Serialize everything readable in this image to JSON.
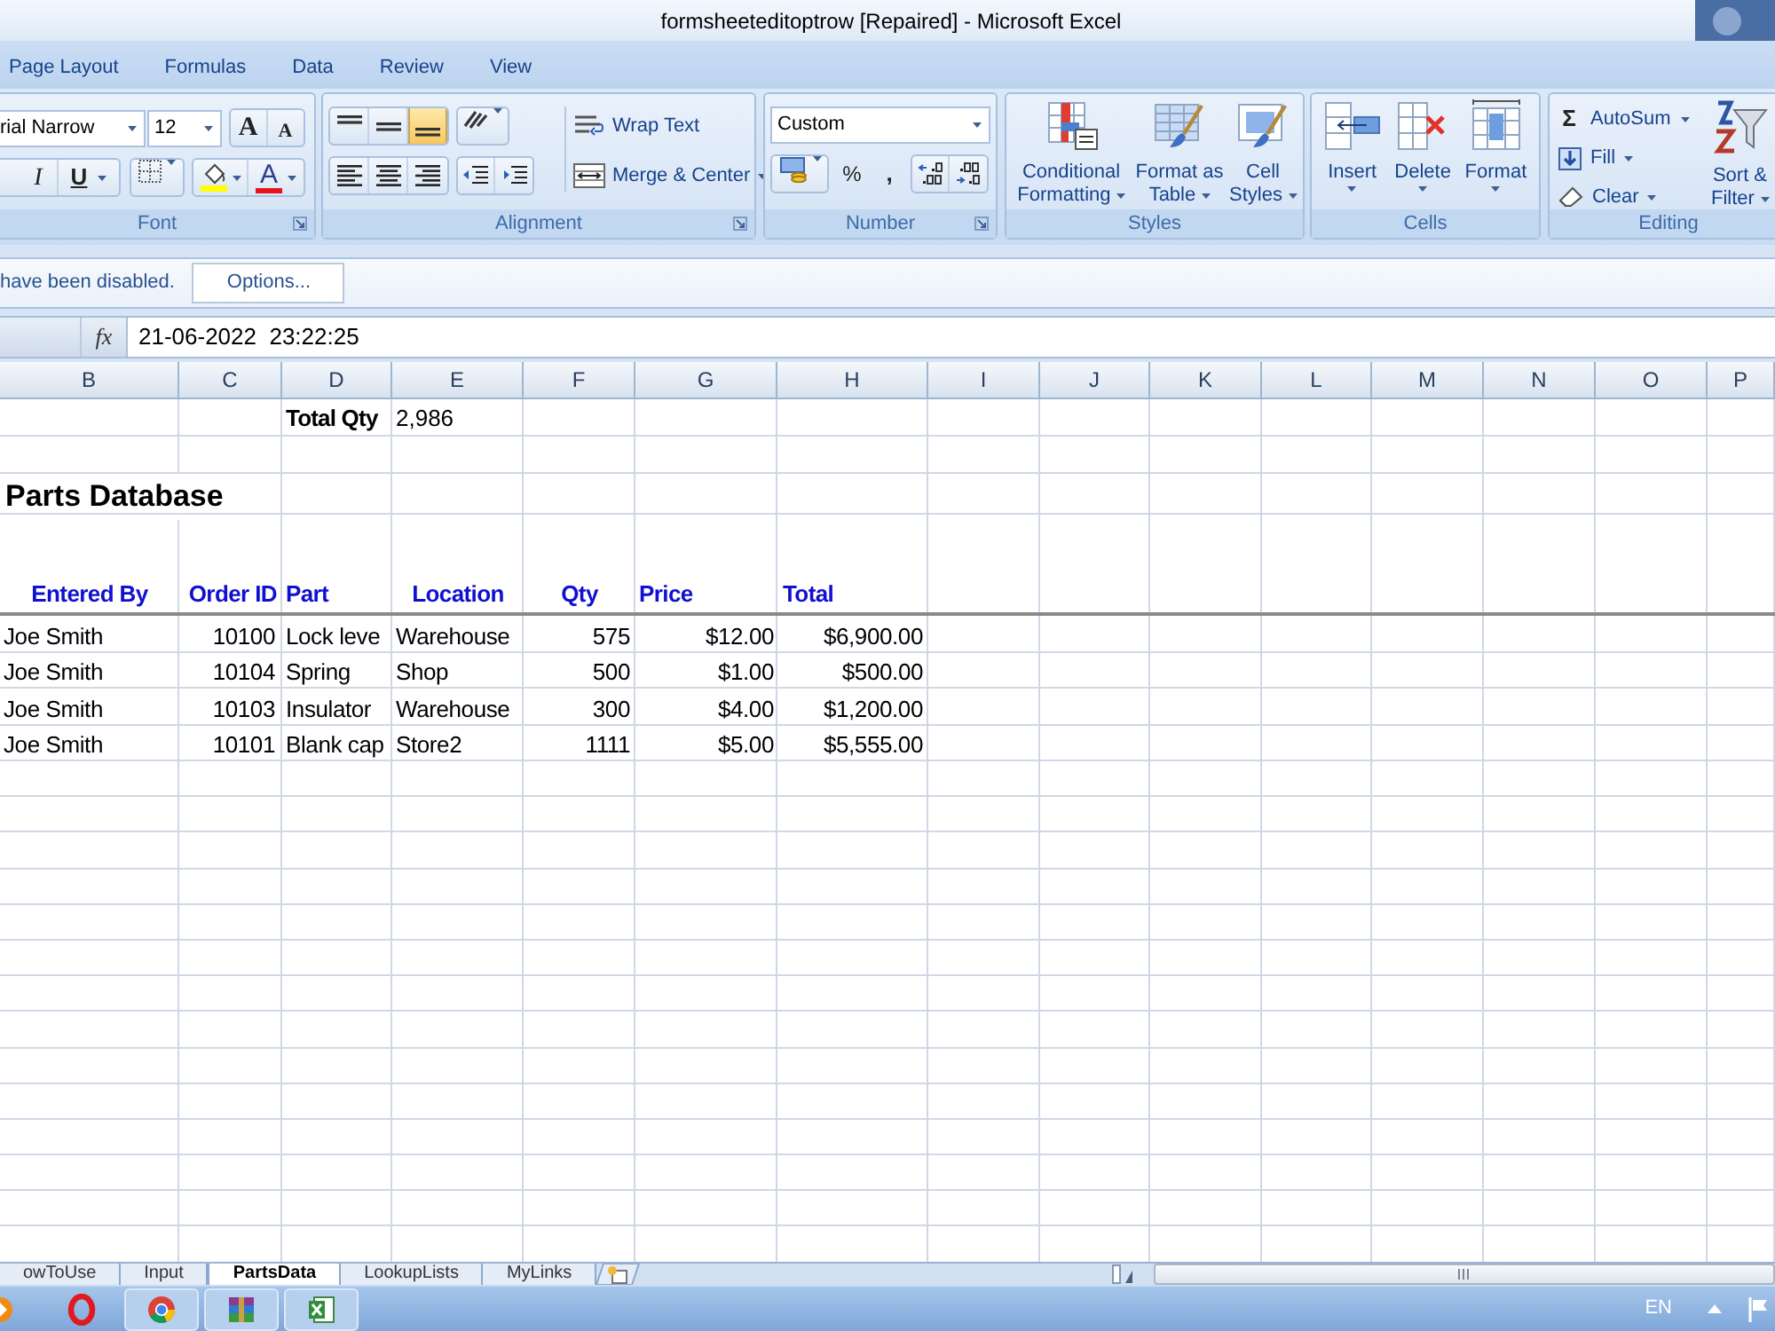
{
  "window": {
    "title": "formsheeteditoptrow [Repaired] - Microsoft Excel"
  },
  "ribbon_tabs": [
    {
      "label": "Page Layout",
      "selected": false
    },
    {
      "label": "Formulas",
      "selected": false
    },
    {
      "label": "Data",
      "selected": false
    },
    {
      "label": "Review",
      "selected": false
    },
    {
      "label": "View",
      "selected": false
    }
  ],
  "ribbon": {
    "font": {
      "label": "Font",
      "font_name": "rial Narrow",
      "font_size": "12",
      "grow_font": "A",
      "shrink_font": "A",
      "italic": "I",
      "underline": "U",
      "font_color": "A"
    },
    "alignment": {
      "label": "Alignment",
      "vertical": [
        {
          "kind": "top",
          "selected": false
        },
        {
          "kind": "middle",
          "selected": false
        },
        {
          "kind": "bottom",
          "selected": true
        }
      ],
      "horizontal": [
        {
          "kind": "left",
          "selected": false
        },
        {
          "kind": "center",
          "selected": false
        },
        {
          "kind": "right",
          "selected": false
        }
      ],
      "wrap_text": "Wrap Text",
      "merge_center": "Merge & Center"
    },
    "number": {
      "label": "Number",
      "format": "Custom",
      "percent": "%",
      "comma": ","
    },
    "styles": {
      "label": "Styles",
      "buttons": [
        {
          "kind": "conditional",
          "label": "Conditional Formatting"
        },
        {
          "kind": "table",
          "label": "Format as Table"
        },
        {
          "kind": "cell",
          "label": "Cell Styles"
        }
      ]
    },
    "cells": {
      "label": "Cells",
      "buttons": [
        {
          "kind": "insert",
          "label": "Insert"
        },
        {
          "kind": "delete",
          "label": "Delete"
        },
        {
          "kind": "format",
          "label": "Format"
        }
      ]
    },
    "editing": {
      "label": "Editing",
      "autosum_symbol": "Σ",
      "autosum": "AutoSum",
      "fill": "Fill",
      "clear": "Clear",
      "sort_filter": "Sort & Filter"
    }
  },
  "message_bar": {
    "text": "have been disabled.",
    "button": "Options..."
  },
  "formula_bar": {
    "function_label": "fx",
    "value": "21-06-2022  23:22:25"
  },
  "sheet": {
    "columns": [
      "B",
      "C",
      "D",
      "E",
      "F",
      "G",
      "H",
      "I",
      "J",
      "K",
      "L",
      "M",
      "N",
      "O",
      "P"
    ],
    "total": {
      "label": "Total Qty",
      "value": "2,986"
    },
    "title": "Parts Database",
    "table": {
      "columns": [
        "Entered By",
        "Order ID",
        "Part",
        "Location",
        "Qty",
        "Price",
        "Total"
      ],
      "rows": [
        [
          "Joe Smith",
          "10100",
          "Lock leve",
          "Warehouse",
          "575",
          "$12.00",
          "$6,900.00"
        ],
        [
          "Joe Smith",
          "10104",
          "Spring",
          "Shop",
          "500",
          "$1.00",
          "$500.00"
        ],
        [
          "Joe Smith",
          "10103",
          "Insulator",
          "Warehouse",
          "300",
          "$4.00",
          "$1,200.00"
        ],
        [
          "Joe Smith",
          "10101",
          "Blank cap",
          "Store2",
          "1111",
          "$5.00",
          "$5,555.00"
        ]
      ]
    }
  },
  "sheet_tabs": [
    {
      "label": "owToUse",
      "selected": false
    },
    {
      "label": "Input",
      "selected": false
    },
    {
      "label": "PartsData",
      "selected": true
    },
    {
      "label": "LookupLists",
      "selected": false
    },
    {
      "label": "MyLinks",
      "selected": false
    }
  ],
  "taskbar": {
    "language": "EN"
  }
}
